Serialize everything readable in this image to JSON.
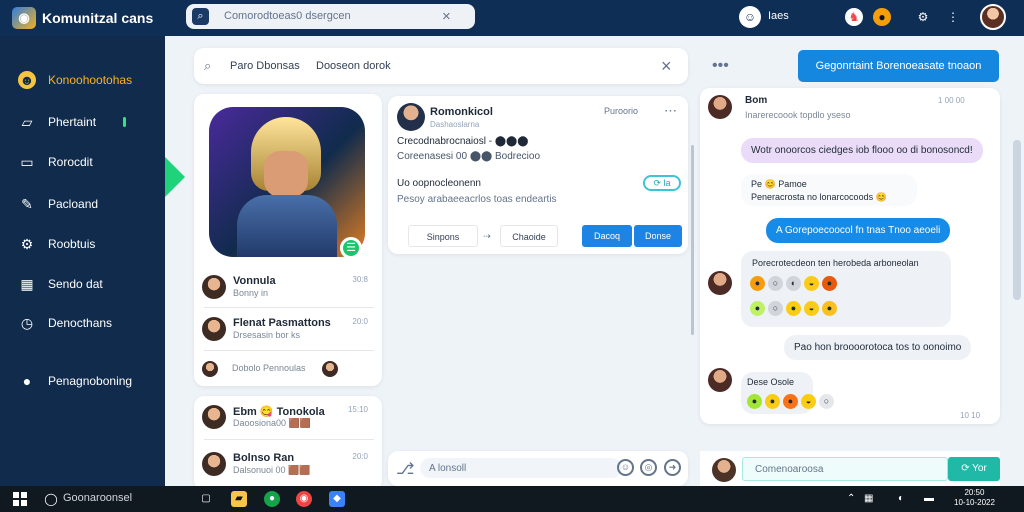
{
  "app": {
    "title": "Komunitzal cans"
  },
  "top_search": {
    "text": "Comorodtoeas0 dsergcen"
  },
  "header": {
    "user_label": "Iaes"
  },
  "sidebar": {
    "items": [
      {
        "label": "Konoohootohas",
        "icon": "☻"
      },
      {
        "label": "Phertaint",
        "icon": "▱"
      },
      {
        "label": "Rorocdit",
        "icon": "▭"
      },
      {
        "label": "Pacloand",
        "icon": "✎"
      },
      {
        "label": "Roobtuis",
        "icon": "⚙"
      },
      {
        "label": "Sendo dat",
        "icon": "▦"
      },
      {
        "label": "Denocthans",
        "icon": "◷"
      },
      {
        "label": "Penagnoboning",
        "icon": "●"
      }
    ]
  },
  "main_search": {
    "placeholder": "Paro Dbonsas",
    "query": "Dooseon dorok"
  },
  "contacts": [
    {
      "name": "Vonnula",
      "sub": "Bonny in",
      "time": "30:8"
    },
    {
      "name": "Flenat Pasmattons",
      "sub": "Drsesasin bor ks",
      "time": "20:0"
    },
    {
      "name": "",
      "sub": "Dobolo Pennoulas",
      "time": ""
    },
    {
      "name": "Ebm 😋 Tonokola",
      "sub": "Daoosiona00 🟫🟫",
      "time": "15:10"
    },
    {
      "name": "Bolnso Ran",
      "sub": "Dalsonuoi 00 🟫🟫",
      "time": "20:0"
    }
  ],
  "post": {
    "name": "Romonkicol",
    "sub": "Dashaoslarna",
    "time": "Puroorio",
    "line1": "Crecodnabrocnaiosl - ⬤⬤⬤",
    "line2": "Coreenasesi 00 ⬤⬤ Bodrecioo",
    "line3": "Uo oopnocleonenn",
    "line4": "Pesoy arabaeeacrlos toas endeartis",
    "pill": "⟳ la",
    "share": "Sinpons",
    "comment": "Chaoide",
    "btn1": "Dacoq",
    "btn2": "Donse"
  },
  "composer": {
    "placeholder": "A lonsoll"
  },
  "chat_header": {
    "dots": "•••",
    "button": "Gegonrtaint Borenoeasate tnoaon"
  },
  "chat": {
    "top_name": "Bom",
    "top_sub": "Inarerecoook topdlo yseso",
    "top_time": "1 00 00",
    "msg1": "Wotr onoorcos ciedges iob flooo oo di bonosoncd!",
    "msg2": "Pe 😊 Pamoe",
    "msg2b": "Peneracrosta no lonarcocoods 😊",
    "msg3": "A Gorepoecoocol fn tnas Tnoo aeoeli",
    "msg4": "Porecrotecdeon ten herobeda arboneolan",
    "msg5": "Pao hon broooorotoca tos to oonoimo",
    "msg6": "Dese Osole",
    "time_bottom": "10 10"
  },
  "chat_footer": {
    "placeholder": "Comenoaroosa",
    "send": "⟳ Yor"
  },
  "taskbar": {
    "search": "Goonaroonsel",
    "clock_time": "20:50",
    "clock_date": "10-10-2022"
  }
}
